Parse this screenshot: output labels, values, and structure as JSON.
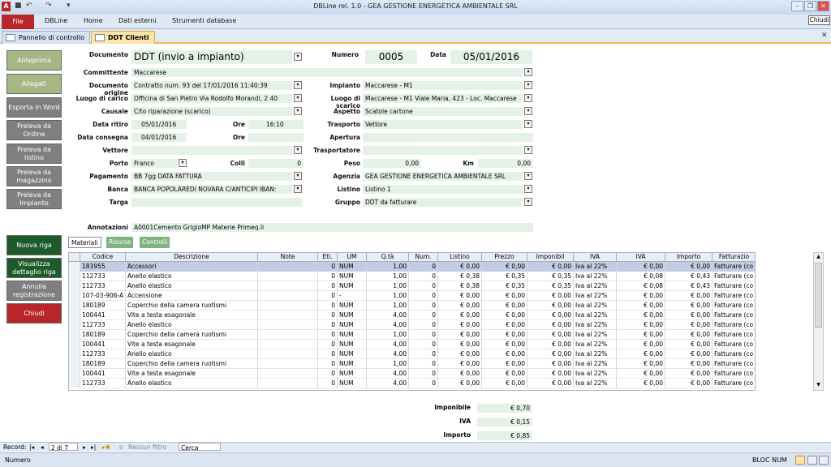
{
  "app": {
    "title": "DBLine rel. 1.0 - GEA GESTIONE ENERGETICA AMBIENTALE SRL",
    "tooltip": "Chiudi",
    "qat_icons": [
      "access-icon",
      "save-icon",
      "undo-icon",
      "redo-icon",
      "customize-icon"
    ]
  },
  "ribbon": {
    "file": "File",
    "tabs": [
      "DBLine",
      "Home",
      "Dati esterni",
      "Strumenti database"
    ]
  },
  "doc_tabs": [
    "Pannello di controllo",
    "DDT Clienti"
  ],
  "side_buttons": [
    {
      "label": "Anteprima",
      "color": "#a6b784"
    },
    {
      "label": "Allegati",
      "color": "#a6b784"
    },
    {
      "label": "Esporta in Word",
      "color": "#7f7f7f"
    },
    {
      "label": "Preleva da Ordine",
      "color": "#7f7f7f"
    },
    {
      "label": "Preleva da listino",
      "color": "#7f7f7f"
    },
    {
      "label": "Preleva da magazzino",
      "color": "#7f7f7f"
    },
    {
      "label": "Preleva da Impianto",
      "color": "#7f7f7f"
    }
  ],
  "side_buttons2": [
    {
      "label": "Nuova riga",
      "color": "#1e5b2b"
    },
    {
      "label": "Visualizza dettaglio riga",
      "color": "#1e5b2b"
    },
    {
      "label": "Annulla registrazione",
      "color": "#7f7f7f"
    },
    {
      "label": "Chiudi",
      "color": "#b8262a"
    }
  ],
  "form": {
    "documento_lbl": "Documento",
    "documento": "DDT (invio a impianto)",
    "numero_lbl": "Numero",
    "numero": "0005",
    "data_lbl": "Data",
    "data": "05/01/2016",
    "committente_lbl": "Committente",
    "committente": "Maccarese",
    "doc_origine_lbl": "Documento origine",
    "doc_origine": "Contratto num. 93 del 17/01/2016 11:40:39",
    "impianto_lbl": "Impianto",
    "impianto": "Maccarese - M1",
    "luogo_carico_lbl": "Luogo di carico",
    "luogo_carico": "Officina di San Pietro Via Rodolfo Morandi, 2 40",
    "luogo_scarico_lbl": "Luogo di scarico",
    "luogo_scarico": "Maccarese - M1 Viale Maria, 423 - Loc. Maccarese",
    "causale_lbl": "Causale",
    "causale": "C/to riparazione (scarico)",
    "aspetto_lbl": "Aspetto",
    "aspetto": "Scatole cartone",
    "data_ritiro_lbl": "Data ritiro",
    "data_ritiro": "05/01/2016",
    "ore_lbl": "Ore",
    "ore_ritiro": "16:10",
    "trasporto_lbl": "Trasporto",
    "trasporto": "Vettore",
    "data_consegna_lbl": "Data consegna",
    "data_consegna": "04/01/2016",
    "ore_consegna": "",
    "apertura_lbl": "Apertura",
    "apertura": "",
    "vettore_lbl": "Vettore",
    "vettore": "",
    "trasportatore_lbl": "Trasportatore",
    "trasportatore": "",
    "porto_lbl": "Porto",
    "porto": "Franco",
    "colli_lbl": "Colli",
    "colli": "0",
    "peso_lbl": "Peso",
    "peso": "0,00",
    "km_lbl": "Km",
    "km": "0,00",
    "pagamento_lbl": "Pagamento",
    "pagamento": "BB 7gg DATA FATTURA",
    "agenzia_lbl": "Agenzia",
    "agenzia": "GEA GESTIONE ENERGETICA AMBIENTALE SRL",
    "banca_lbl": "Banca",
    "banca": "BANCA POPOLAREDI NOVARA C/ANTICIPI IBAN:",
    "listino_lbl": "Listino",
    "listino": "Listino 1",
    "targa_lbl": "Targa",
    "targa": "",
    "gruppo_lbl": "Gruppo",
    "gruppo": "DDT da fatturare",
    "annotazioni_lbl": "Annotazioni",
    "annotazioni": "A0001Cemento GrigioMP Materie Primeq.li"
  },
  "grid_tabs": [
    {
      "label": "Materiali",
      "bg": "#ffffff",
      "fg": "#000"
    },
    {
      "label": "Risorse",
      "bg": "#7fb37f",
      "fg": "#fff"
    },
    {
      "label": "Controlli",
      "bg": "#7fb37f",
      "fg": "#fff"
    }
  ],
  "grid": {
    "headers": [
      "Codice",
      "Descrizione",
      "Note",
      "Eti.",
      "UM",
      "Q.tà",
      "Num.",
      "Listino",
      "Prezzo",
      "Imponibil",
      "IVA",
      "IVA",
      "Importo",
      "Fatturazio"
    ],
    "rows": [
      [
        "183955",
        "Accessori",
        "",
        "0",
        "NUM",
        "1,00",
        "0",
        "€ 0,00",
        "€ 0,00",
        "€ 0,00",
        "Iva al 22%",
        "€ 0,00",
        "€ 0,00",
        "Fatturare (co"
      ],
      [
        "112733",
        "Anello elastico",
        "",
        "0",
        "NUM",
        "1,00",
        "0",
        "€ 0,38",
        "€ 0,35",
        "€ 0,35",
        "Iva al 22%",
        "€ 0,08",
        "€ 0,43",
        "Fatturare (co"
      ],
      [
        "112733",
        "Anello elastico",
        "",
        "0",
        "NUM",
        "1,00",
        "0",
        "€ 0,38",
        "€ 0,35",
        "€ 0,35",
        "Iva al 22%",
        "€ 0,08",
        "€ 0,43",
        "Fatturare (co"
      ],
      [
        "107-03-906-A",
        "Accensione",
        "",
        "0",
        "-",
        "1,00",
        "0",
        "€ 0,00",
        "€ 0,00",
        "€ 0,00",
        "Iva al 22%",
        "€ 0,00",
        "€ 0,00",
        "Fatturare (co"
      ],
      [
        "180189",
        "Coperchio della camera ruotismi",
        "",
        "0",
        "NUM",
        "1,00",
        "0",
        "€ 0,00",
        "€ 0,00",
        "€ 0,00",
        "Iva al 22%",
        "€ 0,00",
        "€ 0,00",
        "Fatturare (co"
      ],
      [
        "100441",
        "Vite a testa esagonale",
        "",
        "0",
        "NUM",
        "4,00",
        "0",
        "€ 0,00",
        "€ 0,00",
        "€ 0,00",
        "Iva al 22%",
        "€ 0,00",
        "€ 0,00",
        "Fatturare (co"
      ],
      [
        "112733",
        "Anello elastico",
        "",
        "0",
        "NUM",
        "4,00",
        "0",
        "€ 0,00",
        "€ 0,00",
        "€ 0,00",
        "Iva al 22%",
        "€ 0,00",
        "€ 0,00",
        "Fatturare (co"
      ],
      [
        "180189",
        "Coperchio della camera ruotismi",
        "",
        "0",
        "NUM",
        "1,00",
        "0",
        "€ 0,00",
        "€ 0,00",
        "€ 0,00",
        "Iva al 22%",
        "€ 0,00",
        "€ 0,00",
        "Fatturare (co"
      ],
      [
        "100441",
        "Vite a testa esagonale",
        "",
        "0",
        "NUM",
        "4,00",
        "0",
        "€ 0,00",
        "€ 0,00",
        "€ 0,00",
        "Iva al 22%",
        "€ 0,00",
        "€ 0,00",
        "Fatturare (co"
      ],
      [
        "112733",
        "Anello elastico",
        "",
        "0",
        "NUM",
        "4,00",
        "0",
        "€ 0,00",
        "€ 0,00",
        "€ 0,00",
        "Iva al 22%",
        "€ 0,00",
        "€ 0,00",
        "Fatturare (co"
      ],
      [
        "180189",
        "Coperchio della camera ruotismi",
        "",
        "0",
        "NUM",
        "1,00",
        "0",
        "€ 0,00",
        "€ 0,00",
        "€ 0,00",
        "Iva al 22%",
        "€ 0,00",
        "€ 0,00",
        "Fatturare (co"
      ],
      [
        "100441",
        "Vite a testa esagonale",
        "",
        "0",
        "NUM",
        "4,00",
        "0",
        "€ 0,00",
        "€ 0,00",
        "€ 0,00",
        "Iva al 22%",
        "€ 0,00",
        "€ 0,00",
        "Fatturare (co"
      ],
      [
        "112733",
        "Anello elastico",
        "",
        "0",
        "NUM",
        "4,00",
        "0",
        "€ 0,00",
        "€ 0,00",
        "€ 0,00",
        "Iva al 22%",
        "€ 0,00",
        "€ 0,00",
        "Fatturare (co"
      ]
    ]
  },
  "totals": {
    "imponibile_lbl": "Imponibile",
    "imponibile": "€ 0,70",
    "iva_lbl": "IVA",
    "iva": "€ 0,15",
    "importo_lbl": "Importo",
    "importo": "€ 0,85"
  },
  "navbar": {
    "record_lbl": "Record:",
    "record": "2 di 7",
    "no_filter": "Nessun filtro",
    "search": "Cerca"
  },
  "status": {
    "left": "Numero",
    "bloc_num": "BLOC NUM"
  }
}
